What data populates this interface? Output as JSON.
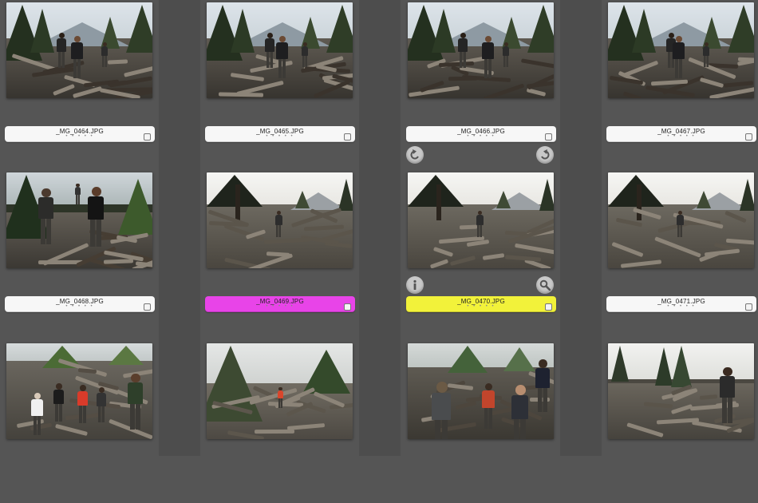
{
  "browser": {
    "label_colors": {
      "none": "#f7f7f7",
      "purple": "#e844e8",
      "yellow": "#f2f23a"
    },
    "photos": [
      {
        "filename": "_MG_0464.JPG",
        "rating": "• • • • •",
        "label": "none",
        "scene": "people-woods"
      },
      {
        "filename": "_MG_0465.JPG",
        "rating": "• • • • •",
        "label": "none",
        "scene": "people-woods"
      },
      {
        "filename": "_MG_0466.JPG",
        "rating": "• • • • •",
        "label": "none",
        "scene": "people-woods"
      },
      {
        "filename": "_MG_0467.JPG",
        "rating": "• • • • •",
        "label": "none",
        "scene": "people-woods"
      },
      {
        "filename": "_MG_0468.JPG",
        "rating": "• • • • •",
        "label": "none",
        "scene": "people-close"
      },
      {
        "filename": "_MG_0469.JPG",
        "rating": "• • • • •",
        "label": "purple",
        "scene": "debris-backlit"
      },
      {
        "filename": "_MG_0470.JPG",
        "rating": "• • • • •",
        "label": "yellow",
        "scene": "debris-backlit"
      },
      {
        "filename": "_MG_0471.JPG",
        "rating": "• • • • •",
        "label": "none",
        "scene": "debris-backlit"
      },
      {
        "filename": "",
        "rating": "",
        "label": "none",
        "scene": "group-debris"
      },
      {
        "filename": "",
        "rating": "",
        "label": "none",
        "scene": "tree-debris"
      },
      {
        "filename": "",
        "rating": "",
        "label": "none",
        "scene": "group-close"
      },
      {
        "filename": "",
        "rating": "",
        "label": "none",
        "scene": "woods-person"
      }
    ],
    "hover_controls": {
      "rotate_left": "rotate-left-icon",
      "rotate_right": "rotate-right-icon",
      "info": "info-icon",
      "zoom": "zoom-icon"
    }
  }
}
